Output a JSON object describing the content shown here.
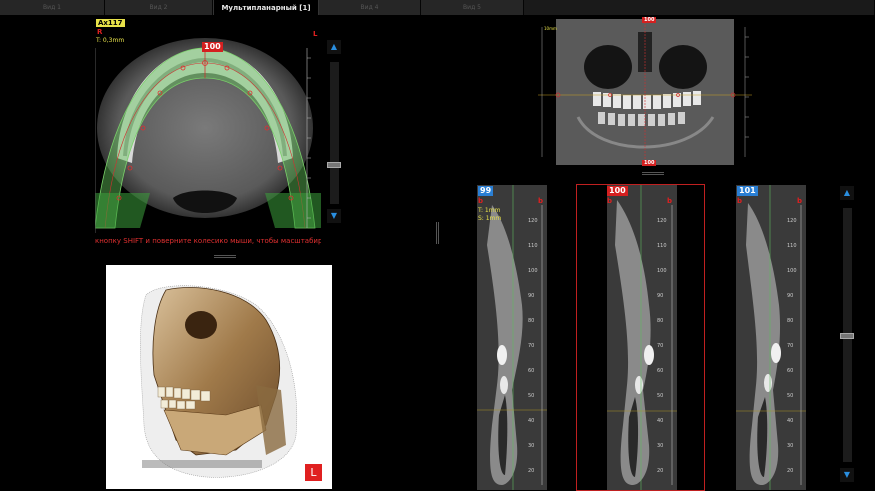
{
  "tabs": [
    {
      "label": "Вид 1",
      "active": false
    },
    {
      "label": "Вид 2",
      "active": false
    },
    {
      "label": "Мультипланарный  [1]",
      "active": true
    },
    {
      "label": "Вид 4",
      "active": false
    },
    {
      "label": "Вид 5",
      "active": false
    }
  ],
  "axial": {
    "slice_label": "Ax117",
    "orientation": "R",
    "thickness": "T: 0,3mm",
    "center_marker": "100",
    "corner_marker": "L",
    "hint": "кнопку SHIFT и поверните колесико мыши, чтобы масштабиров"
  },
  "coronal": {
    "top_marker": "100",
    "bottom_marker": "100",
    "scale_label": "10mm"
  },
  "render3d": {
    "corner_marker": "L"
  },
  "cross_sections": [
    {
      "slice": "99",
      "color": "#2a7fd4",
      "side_left": "b",
      "side_right": "b",
      "thickness": "T: 1mm",
      "spacing": "S: 1mm",
      "selected": false
    },
    {
      "slice": "100",
      "color": "#d42020",
      "side_left": "b",
      "side_right": "b",
      "thickness": "",
      "spacing": "",
      "selected": true
    },
    {
      "slice": "101",
      "color": "#2a7fd4",
      "side_left": "b",
      "side_right": "b",
      "thickness": "",
      "spacing": "",
      "selected": false
    }
  ],
  "ruler_ticks": [
    "120",
    "110",
    "100",
    "90",
    "80",
    "70",
    "60",
    "50",
    "40",
    "30",
    "20"
  ],
  "scroll": {
    "up": "▲",
    "down": "▼"
  },
  "colors": {
    "accent_blue": "#2a8fe0",
    "selected_red": "#d42020",
    "label_yellow": "#e8e24a"
  }
}
